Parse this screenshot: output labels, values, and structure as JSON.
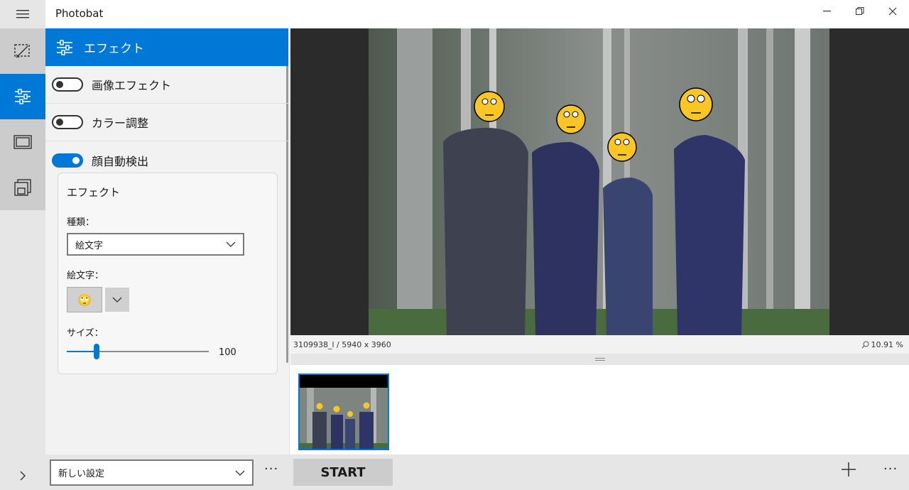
{
  "app": {
    "title": "Photobat"
  },
  "rail": {
    "items": [
      "crop-icon",
      "adjust-icon",
      "frame-icon",
      "layers-icon"
    ],
    "active_index": 1
  },
  "panel": {
    "header": "エフェクト",
    "toggles": [
      {
        "label": "画像エフェクト",
        "on": false
      },
      {
        "label": "カラー調整",
        "on": false
      },
      {
        "label": "顔自動検出",
        "on": true
      }
    ],
    "card": {
      "title": "エフェクト",
      "type_label": "種類：",
      "type_value": "絵文字",
      "emoji_label": "絵文字：",
      "emoji_value": "🙄",
      "size_label": "サイズ：",
      "size_value": "100",
      "size_fraction": 0.21
    }
  },
  "bottom": {
    "preset_value": "新しい設定",
    "more_label": "···",
    "start_label": "START"
  },
  "viewer": {
    "file_info": "3109938_l / 5940 x 3960",
    "zoom": "10.91 %"
  },
  "colors": {
    "accent": "#0078d7",
    "rail": "#e6e6e6",
    "panel": "#f2f2f2"
  }
}
